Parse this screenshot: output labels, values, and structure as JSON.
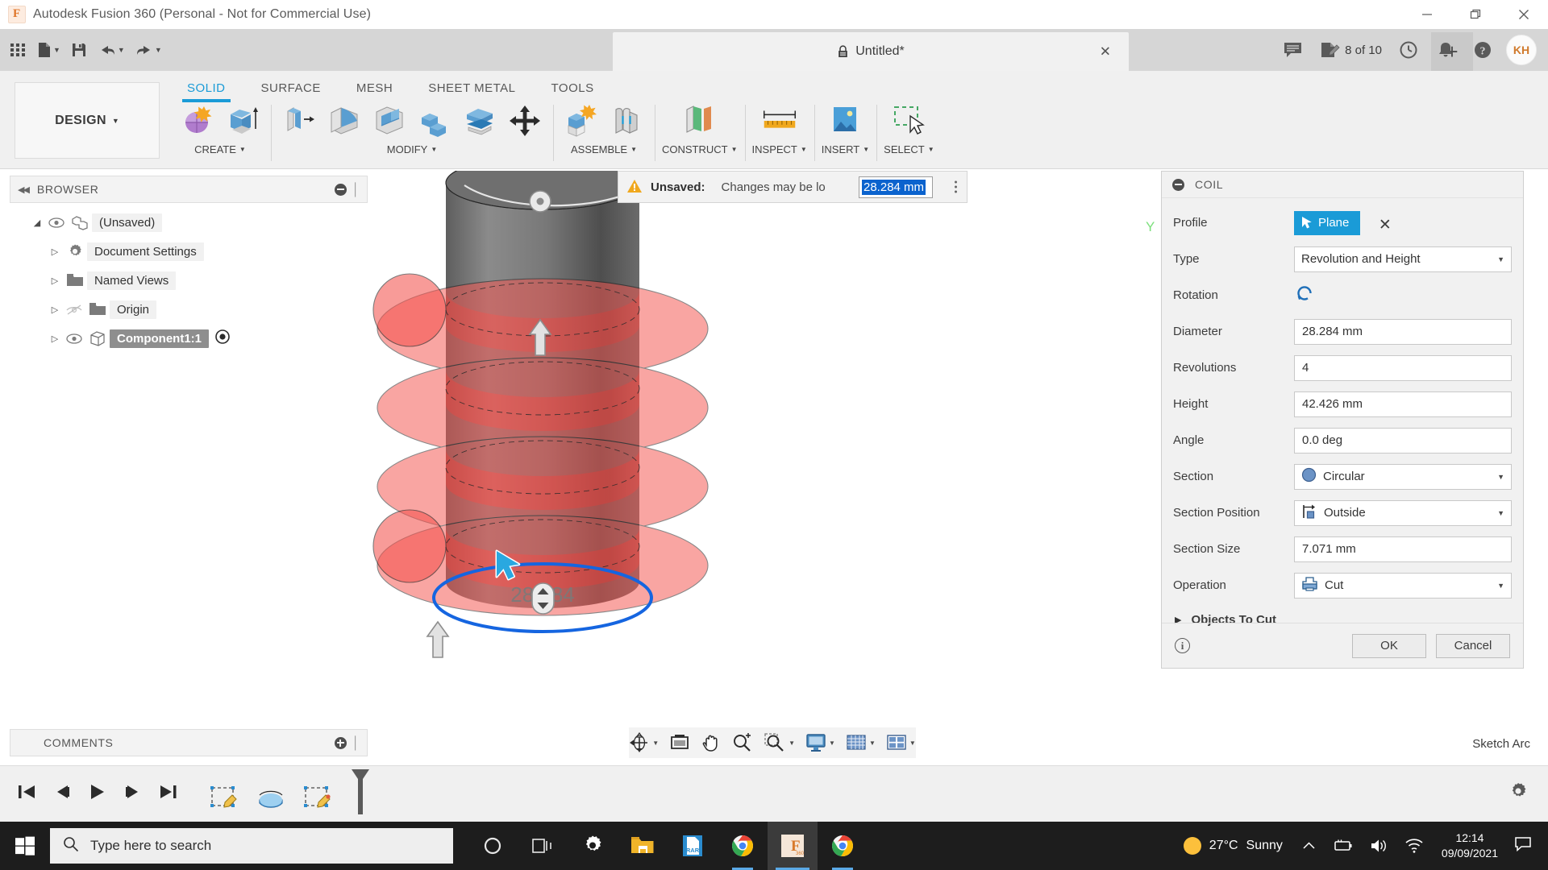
{
  "window": {
    "title": "Autodesk Fusion 360 (Personal - Not for Commercial Use)",
    "minimize_label": "Minimize",
    "maximize_label": "Restore",
    "close_label": "Close"
  },
  "quick_access": {
    "grid_label": "App Grid",
    "new_label": "New",
    "save_label": "Save",
    "undo_label": "Undo",
    "redo_label": "Redo",
    "caret": "▼"
  },
  "tabs": {
    "document": {
      "label": "Untitled*",
      "close": "✕"
    },
    "new_tab": "+"
  },
  "account_bar": {
    "comments_label": "Comments",
    "jobs_label": "Job Status",
    "jobs_count": "8 of 10",
    "recent_label": "Recent",
    "notifications_label": "Notifications",
    "help_label": "Help",
    "avatar_initials": "KH"
  },
  "ribbon": {
    "workspace": {
      "label": "DESIGN",
      "caret": "▼"
    },
    "tabs": [
      {
        "label": "SOLID",
        "active": true
      },
      {
        "label": "SURFACE",
        "active": false
      },
      {
        "label": "MESH",
        "active": false
      },
      {
        "label": "SHEET METAL",
        "active": false
      },
      {
        "label": "TOOLS",
        "active": false
      }
    ],
    "panels": [
      {
        "label": "CREATE",
        "caret": "▼"
      },
      {
        "label": "MODIFY",
        "caret": "▼"
      },
      {
        "label": "ASSEMBLE",
        "caret": "▼"
      },
      {
        "label": "CONSTRUCT",
        "caret": "▼"
      },
      {
        "label": "INSPECT",
        "caret": "▼"
      },
      {
        "label": "INSERT",
        "caret": "▼"
      },
      {
        "label": "SELECT",
        "caret": "▼"
      }
    ]
  },
  "browser": {
    "title": "BROWSER",
    "collapse_label": "◀◀",
    "items": [
      {
        "label": "(Unsaved)",
        "arrow": "◢",
        "depth": 0,
        "eye": true,
        "visible": true,
        "selected": false
      },
      {
        "label": "Document Settings",
        "arrow": "▷",
        "depth": 1,
        "eye": false,
        "visible": true,
        "selected": false
      },
      {
        "label": "Named Views",
        "arrow": "▷",
        "depth": 1,
        "eye": false,
        "visible": true,
        "selected": false
      },
      {
        "label": "Origin",
        "arrow": "▷",
        "depth": 1,
        "eye": true,
        "visible": false,
        "selected": false
      },
      {
        "label": "Component1:1",
        "arrow": "▷",
        "depth": 1,
        "eye": true,
        "visible": true,
        "selected": true
      }
    ]
  },
  "toast": {
    "warning_icon": "⚠",
    "title": "Unsaved:",
    "message": "Changes may be lo",
    "edit_value": "28.284 mm",
    "overflow": "⋮"
  },
  "coil": {
    "title": "COIL",
    "profile": {
      "label": "Profile",
      "button": "Plane",
      "clear": "✕"
    },
    "fields": [
      {
        "label": "Type",
        "value": "Revolution and Height",
        "kind": "select",
        "icon": ""
      },
      {
        "label": "Rotation",
        "value": "",
        "kind": "icon-only",
        "icon": "rotation-icon"
      },
      {
        "label": "Diameter",
        "value": "28.284 mm",
        "kind": "input",
        "icon": ""
      },
      {
        "label": "Revolutions",
        "value": "4",
        "kind": "input",
        "icon": ""
      },
      {
        "label": "Height",
        "value": "42.426 mm",
        "kind": "input",
        "icon": ""
      },
      {
        "label": "Angle",
        "value": "0.0 deg",
        "kind": "input",
        "icon": ""
      },
      {
        "label": "Section",
        "value": "Circular",
        "kind": "select",
        "icon": "circle-icon"
      },
      {
        "label": "Section Position",
        "value": "Outside",
        "kind": "select",
        "icon": "section-position-icon"
      },
      {
        "label": "Section Size",
        "value": "7.071 mm",
        "kind": "input",
        "icon": ""
      },
      {
        "label": "Operation",
        "value": "Cut",
        "kind": "select",
        "icon": "cut-icon"
      }
    ],
    "objects_to_cut": {
      "label": "Objects To Cut",
      "triangle": "▶"
    },
    "info": "i",
    "ok": "OK",
    "cancel": "Cancel"
  },
  "viewport": {
    "dimension_label": "28.284",
    "selected_color": "#1565e0",
    "preview_color": "#f4544f",
    "body_color": "#6e6e6e"
  },
  "comments": {
    "title": "COMMENTS"
  },
  "navbar": {
    "orbit_label": "Orbit",
    "look_at_label": "Look At",
    "pan_label": "Pan",
    "zoom_label": "Zoom",
    "fit_label": "Fit",
    "display_label": "Display Settings",
    "grid_label": "Grid and Snaps",
    "viewports_label": "Viewports",
    "caret": "▼"
  },
  "status": {
    "right_text": "Sketch Arc"
  },
  "timeline": {
    "go_start": "Go to Beginning",
    "step_back": "Step Back",
    "play": "Play",
    "step_forward": "Step Forward",
    "go_end": "Go to End",
    "features": [
      "sketch-feature",
      "revolve-feature",
      "sketch-feature"
    ],
    "settings": "Timeline Settings"
  },
  "taskbar": {
    "start_label": "Start",
    "search_placeholder": "Type here to search",
    "apps": [
      {
        "name": "cortana-icon",
        "active": false,
        "running": false
      },
      {
        "name": "task-view-icon",
        "active": false,
        "running": false
      },
      {
        "name": "settings-icon",
        "active": false,
        "running": false
      },
      {
        "name": "file-explorer-icon",
        "active": false,
        "running": false
      },
      {
        "name": "winrar-icon",
        "active": false,
        "running": false
      },
      {
        "name": "chrome-icon",
        "active": false,
        "running": true
      },
      {
        "name": "fusion360-icon",
        "active": true,
        "running": true
      },
      {
        "name": "chrome-icon",
        "active": false,
        "running": true
      }
    ],
    "tray": {
      "weather_temp": "27°C",
      "weather_desc": "Sunny",
      "expand": "∧",
      "battery_label": "Battery",
      "volume_label": "Volume",
      "network_label": "Network",
      "time": "12:14",
      "date": "09/09/2021",
      "action_center": "Action Center"
    }
  }
}
